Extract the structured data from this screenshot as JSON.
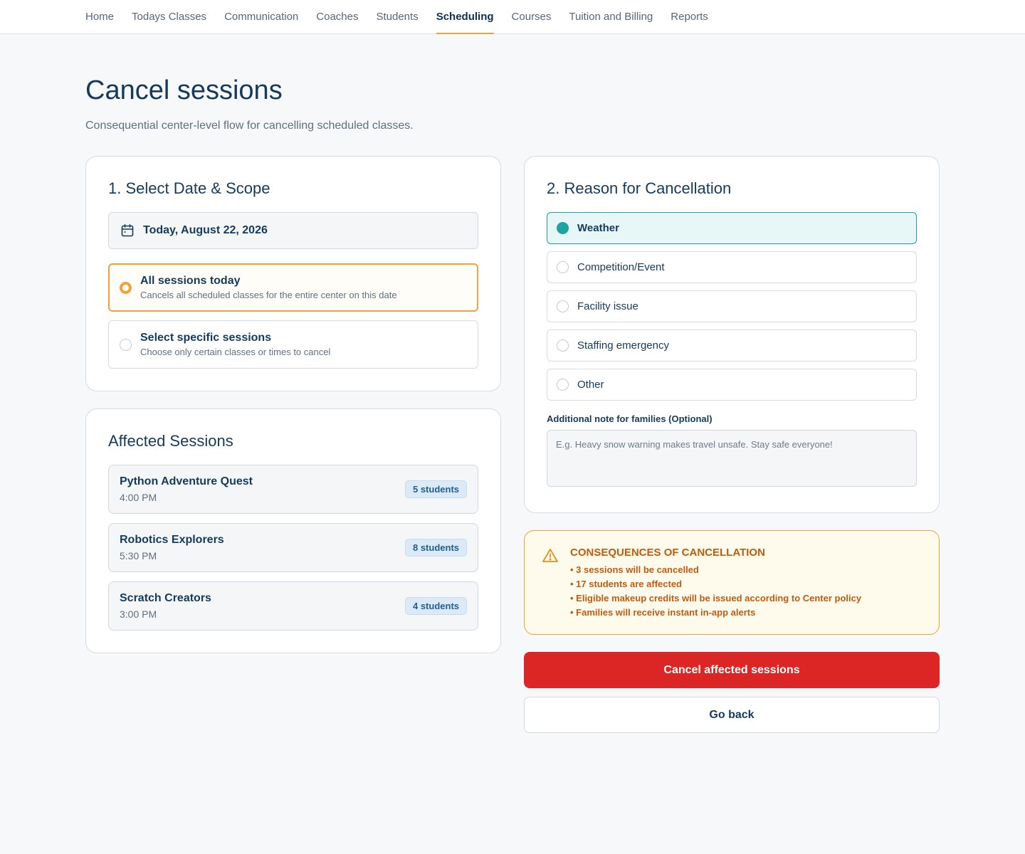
{
  "nav": {
    "items": [
      {
        "label": "Home",
        "active": false
      },
      {
        "label": "Todays Classes",
        "active": false
      },
      {
        "label": "Communication",
        "active": false
      },
      {
        "label": "Coaches",
        "active": false
      },
      {
        "label": "Students",
        "active": false
      },
      {
        "label": "Scheduling",
        "active": true
      },
      {
        "label": "Courses",
        "active": false
      },
      {
        "label": "Tuition and Billing",
        "active": false
      },
      {
        "label": "Reports",
        "active": false
      }
    ]
  },
  "page": {
    "title": "Cancel sessions",
    "subtitle": "Consequential center-level flow for cancelling scheduled classes."
  },
  "scope": {
    "title": "1. Select Date & Scope",
    "date_icon": "calendar-icon",
    "date": "Today, August 22, 2026",
    "options": [
      {
        "label": "All sessions today",
        "desc": "Cancels all scheduled classes for the entire center on this date",
        "selected": true
      },
      {
        "label": "Select specific sessions",
        "desc": "Choose only certain classes or times to cancel",
        "selected": false
      }
    ]
  },
  "affected": {
    "title": "Affected Sessions",
    "sessions": [
      {
        "name": "Python Adventure Quest",
        "time": "4:00 PM",
        "students": "5 students"
      },
      {
        "name": "Robotics Explorers",
        "time": "5:30 PM",
        "students": "8 students"
      },
      {
        "name": "Scratch Creators",
        "time": "3:00 PM",
        "students": "4 students"
      }
    ]
  },
  "reason": {
    "title": "2. Reason for Cancellation",
    "options": [
      {
        "label": "Weather",
        "selected": true
      },
      {
        "label": "Competition/Event",
        "selected": false
      },
      {
        "label": "Facility issue",
        "selected": false
      },
      {
        "label": "Staffing emergency",
        "selected": false
      },
      {
        "label": "Other",
        "selected": false
      }
    ],
    "note_label": "Additional note for families (Optional)",
    "note_placeholder": "E.g. Heavy snow warning makes travel unsafe. Stay safe everyone!",
    "note_value": ""
  },
  "consequences": {
    "icon": "warning-icon",
    "title": "CONSEQUENCES OF CANCELLATION",
    "items": [
      "• 3 sessions will be cancelled",
      "• 17 students are affected",
      "• Eligible makeup credits will be issued according to Center policy",
      "• Families will receive instant in-app alerts"
    ]
  },
  "actions": {
    "cancel_label": "Cancel affected sessions",
    "back_label": "Go back"
  },
  "colors": {
    "accent": "#eea33c",
    "teal": "#1fa2a0",
    "danger": "#dc2626",
    "warning_text": "#c25a0f",
    "text_primary": "#163a5c"
  }
}
